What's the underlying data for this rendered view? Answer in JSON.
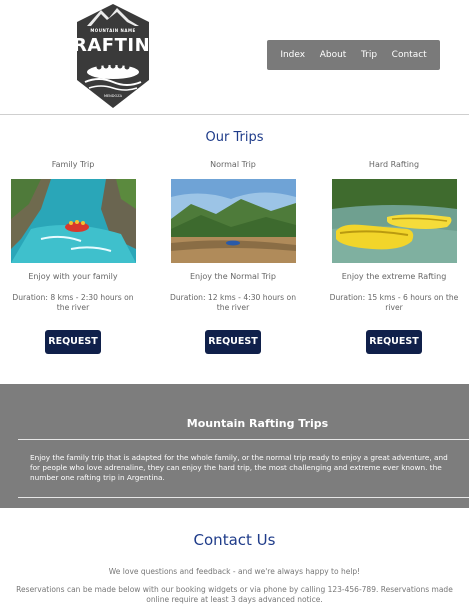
{
  "logo": {
    "subtitle": "MOUNTAIN NAME",
    "title": "RAFTING",
    "tagline": "MENDOZA"
  },
  "nav": [
    "Index",
    "About",
    "Trip",
    "Contact"
  ],
  "trips_section": {
    "title": "Our Trips",
    "trips": [
      {
        "name": "Family Trip",
        "image": "rafting-river-photo",
        "description": "Enjoy with your family",
        "duration": "Duration: 8 kms - 2:30 hours on the river",
        "button": "REQUEST"
      },
      {
        "name": "Normal Trip",
        "image": "mountain-river-photo",
        "description": "Enjoy the Normal Trip",
        "duration": "Duration: 12 kms - 4:30 hours on the river",
        "button": "REQUEST"
      },
      {
        "name": "Hard Rafting",
        "image": "yellow-rafts-photo",
        "description": "Enjoy the extreme Rafting",
        "duration": "Duration: 15 kms - 6 hours on the river",
        "button": "REQUEST"
      }
    ]
  },
  "band": {
    "title": "Mountain Rafting Trips",
    "lines": [
      "Enjoy the family trip that is adapted for the whole family, or the normal trip ready to enjoy a great adventure, and",
      "for people who love adrenaline, they can enjoy the hard trip, the most challenging and extreme ever known. the",
      "number one rafting trip in Argentina."
    ]
  },
  "contact": {
    "title": "Contact Us",
    "line1": "We love questions and feedback - and we're always happy to help!",
    "line2": "Reservations can be made below with our booking widgets or via phone by calling 123-456-789. Reservations made online require at least 3 days advanced notice."
  }
}
